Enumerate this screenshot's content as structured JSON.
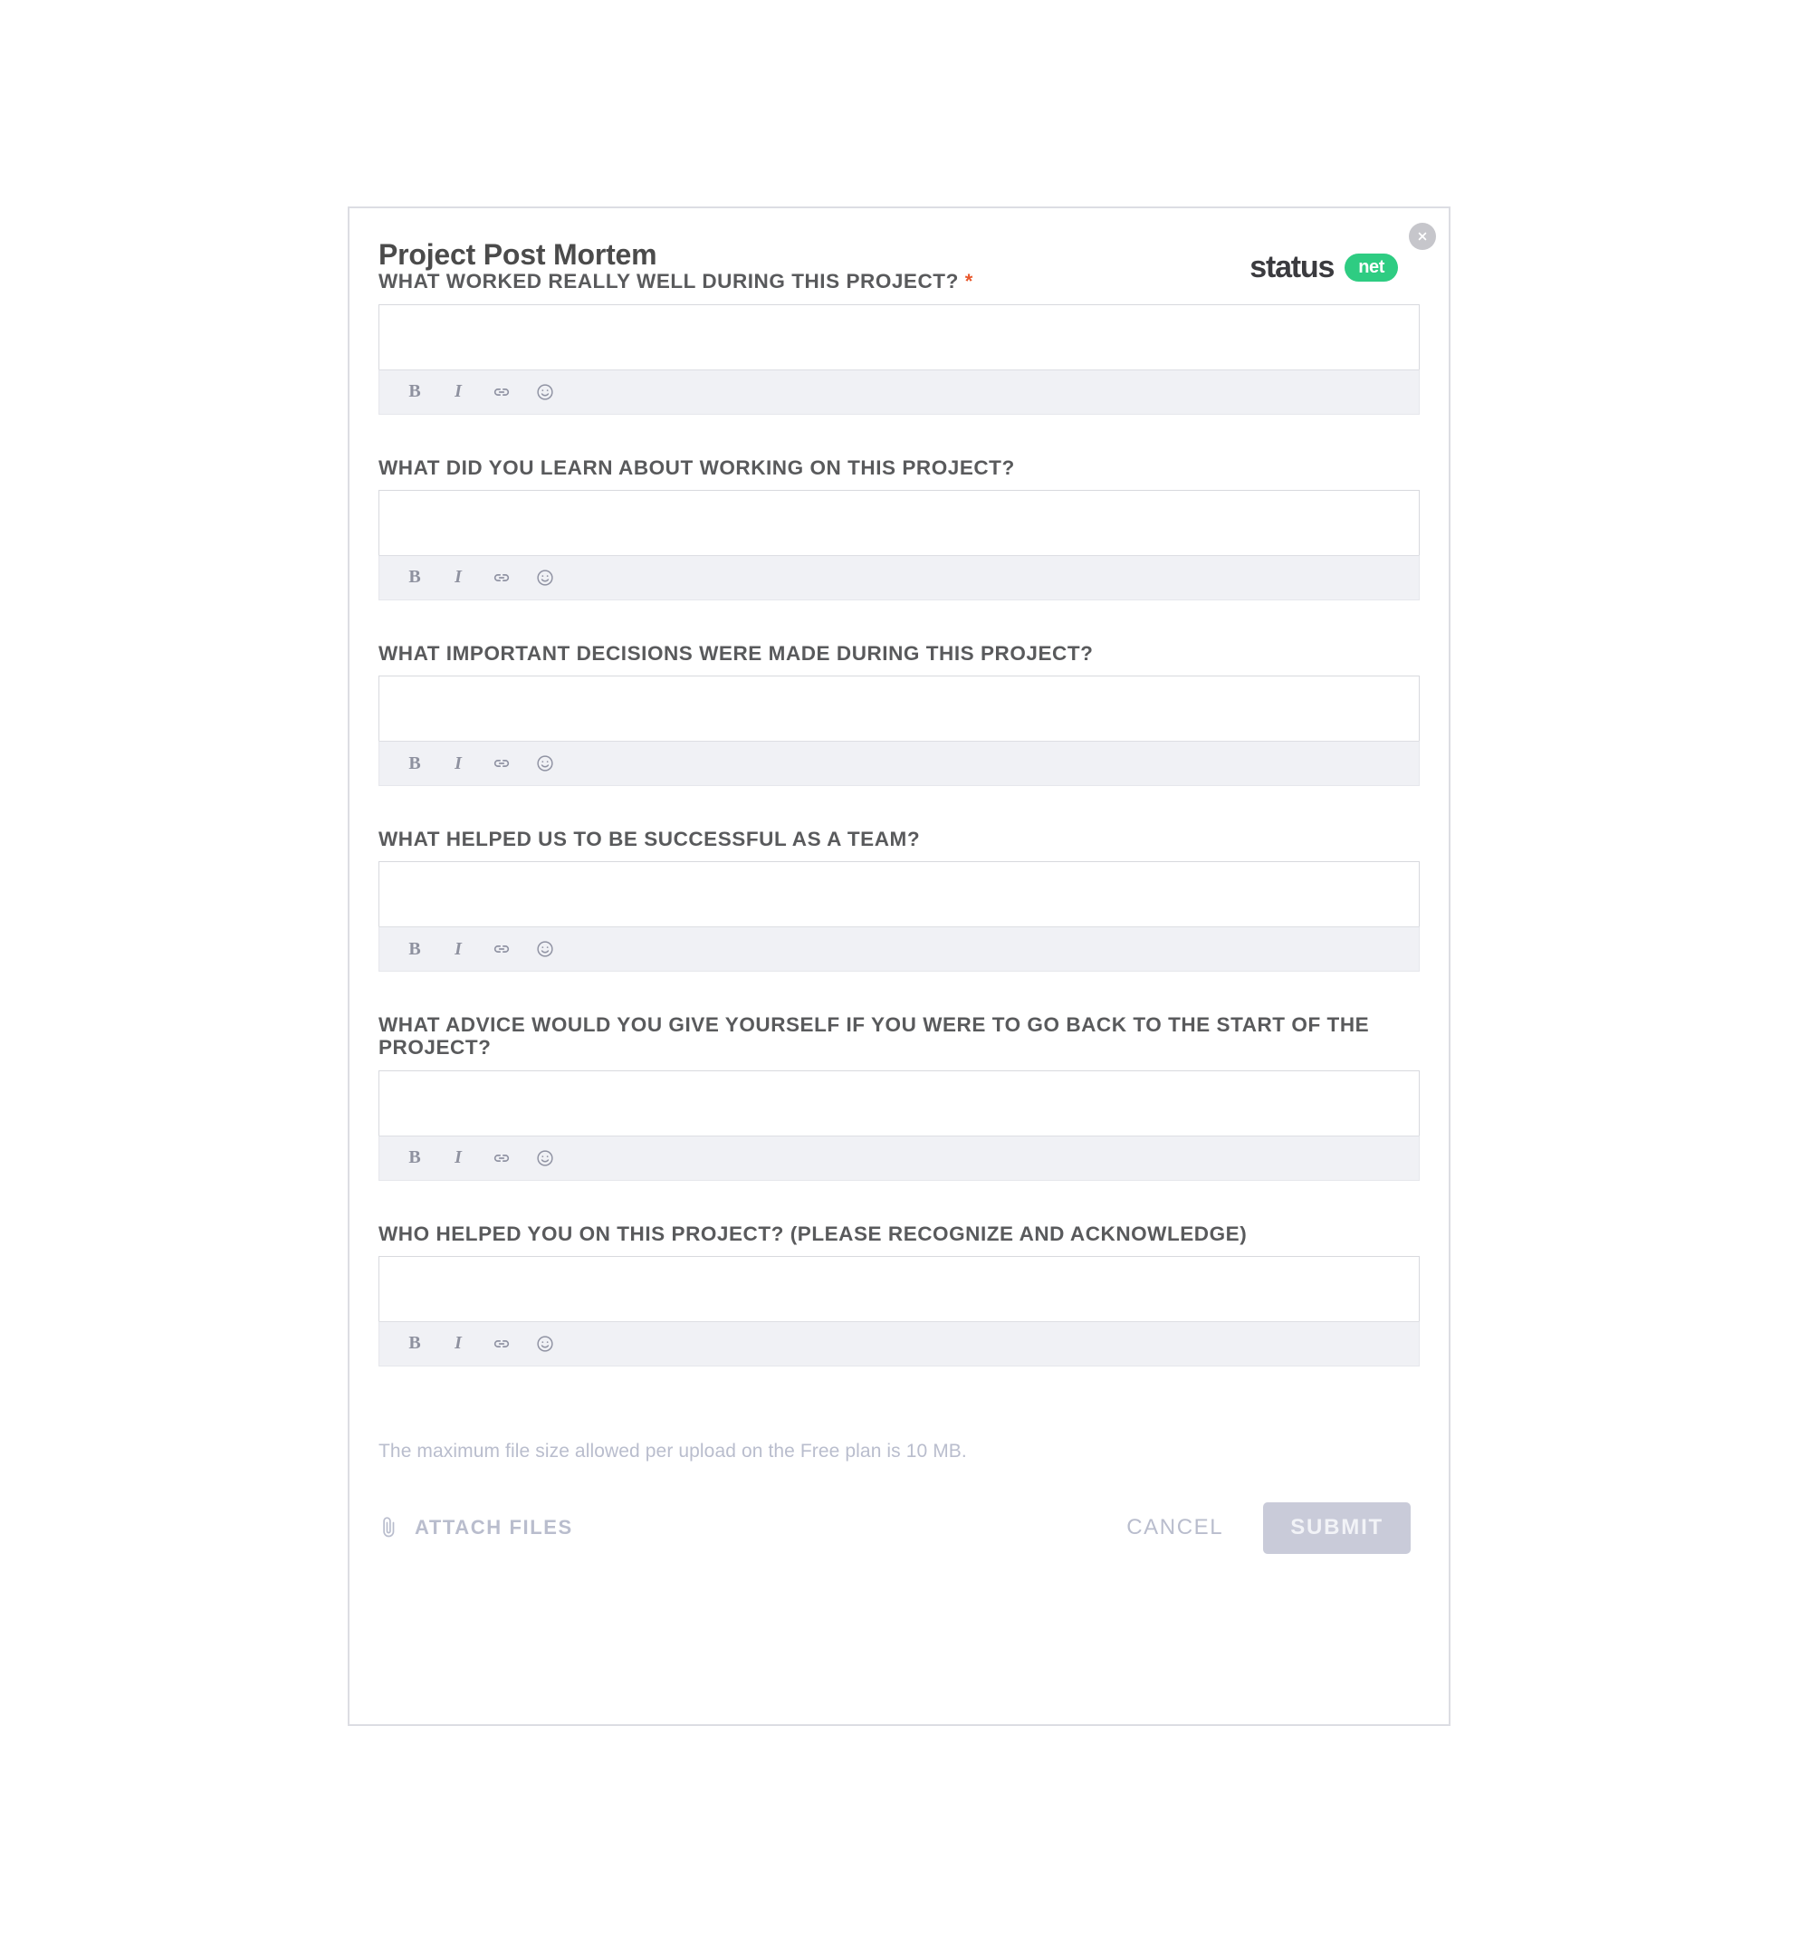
{
  "modal": {
    "title": "Project Post Mortem",
    "close_icon": "close-icon",
    "brand": {
      "word": "status",
      "pill": "net"
    }
  },
  "toolbar": {
    "bold_label": "B",
    "italic_label": "I",
    "link_icon": "link-icon",
    "emoji_icon": "emoji-smiley-icon"
  },
  "questions": [
    {
      "label": "WHAT WORKED REALLY WELL DURING THIS PROJECT?",
      "required": true,
      "required_marker": "*",
      "value": "",
      "placeholder": ""
    },
    {
      "label": "WHAT DID YOU LEARN ABOUT WORKING ON THIS PROJECT?",
      "required": false,
      "required_marker": "",
      "value": "",
      "placeholder": ""
    },
    {
      "label": "WHAT IMPORTANT DECISIONS WERE MADE DURING THIS PROJECT?",
      "required": false,
      "required_marker": "",
      "value": "",
      "placeholder": ""
    },
    {
      "label": "WHAT HELPED US TO BE SUCCESSFUL AS A TEAM?",
      "required": false,
      "required_marker": "",
      "value": "",
      "placeholder": ""
    },
    {
      "label": "WHAT ADVICE WOULD YOU GIVE YOURSELF IF YOU WERE TO GO BACK TO THE START OF THE PROJECT?",
      "required": false,
      "required_marker": "",
      "value": "",
      "placeholder": ""
    },
    {
      "label": "WHO HELPED YOU ON THIS PROJECT? (PLEASE RECOGNIZE AND ACKNOWLEDGE)",
      "required": false,
      "required_marker": "",
      "value": "",
      "placeholder": ""
    }
  ],
  "footer": {
    "file_note": "The maximum file size allowed per upload on the Free plan is 10 MB.",
    "attach_label": "ATTACH FILES",
    "attach_icon": "paperclip-icon",
    "cancel_label": "CANCEL",
    "submit_label": "SUBMIT"
  },
  "colors": {
    "brand_green": "#2ecc82",
    "required_orange": "#e8582c",
    "label_grey": "#595a5c",
    "muted_lavender": "#b9bdcd",
    "submit_disabled": "#c9cbd9",
    "toolbar_bg": "#f0f1f5",
    "card_border": "#dcdde3"
  }
}
